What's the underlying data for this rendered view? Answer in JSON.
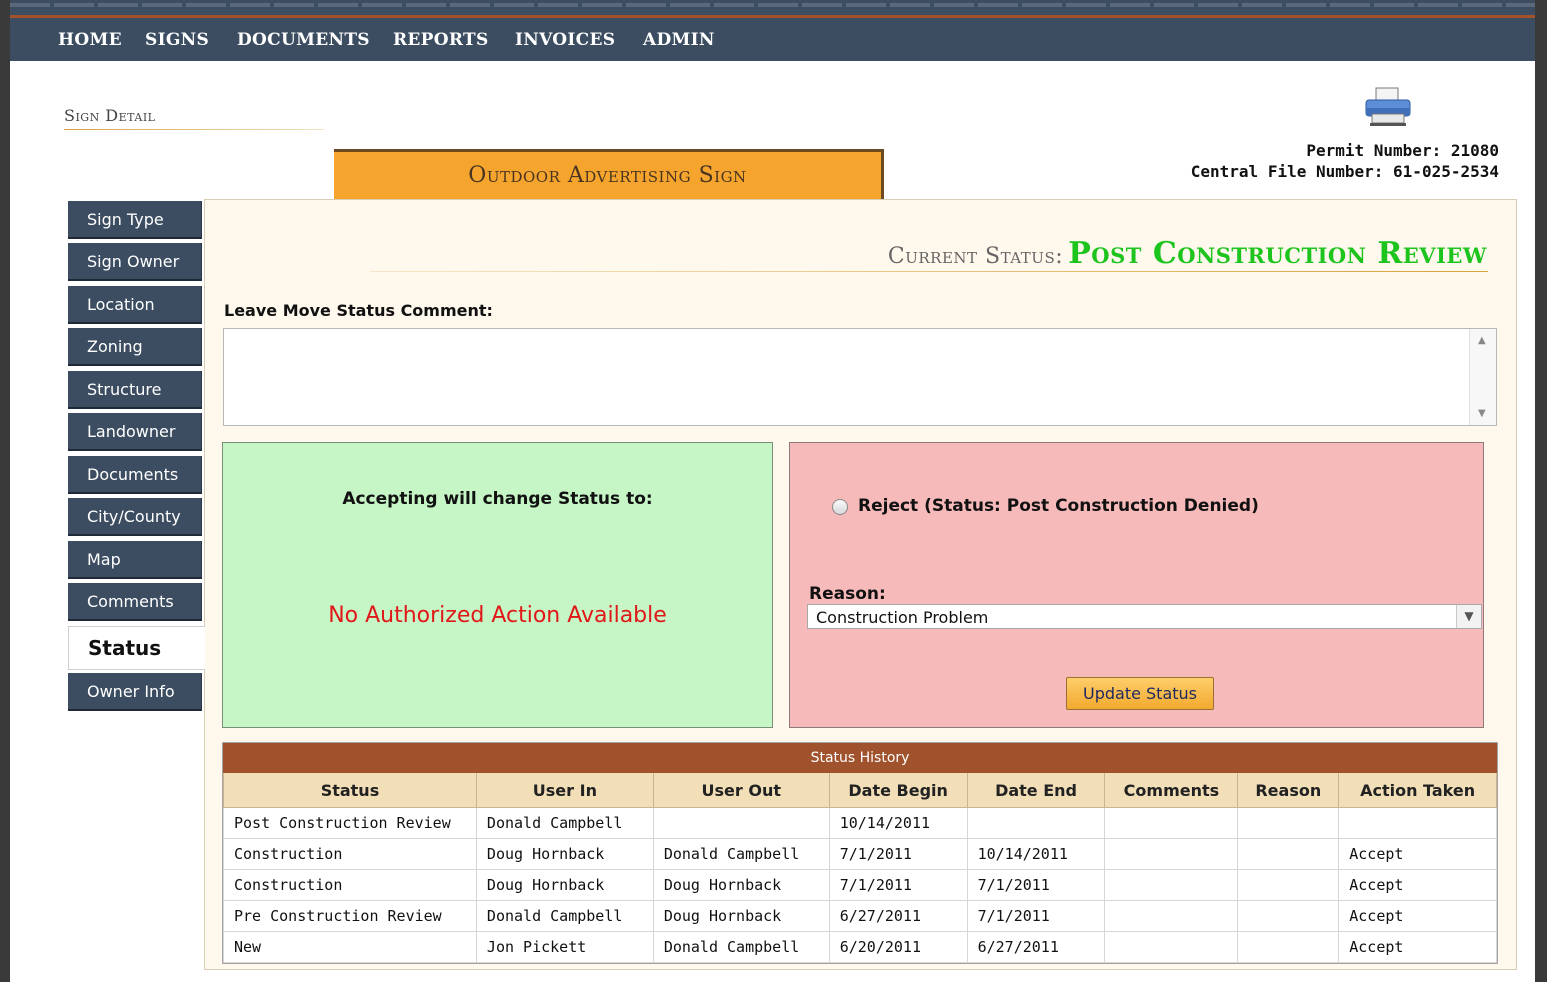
{
  "nav": {
    "home": "HOME",
    "signs": "SIGNS",
    "documents": "DOCUMENTS",
    "reports": "REPORTS",
    "invoices": "INVOICES",
    "admin": "ADMIN"
  },
  "page": {
    "title": "Sign Detail",
    "sign_tab": "Outdoor Advertising Sign",
    "permit_number": "Permit Number: 21080",
    "central_file_number": "Central File Number: 61-025-2534"
  },
  "sidebar": {
    "items": [
      {
        "label": "Sign Type"
      },
      {
        "label": "Sign Owner"
      },
      {
        "label": "Location"
      },
      {
        "label": "Zoning"
      },
      {
        "label": "Structure"
      },
      {
        "label": "Landowner"
      },
      {
        "label": "Documents"
      },
      {
        "label": "City/County"
      },
      {
        "label": "Map"
      },
      {
        "label": "Comments"
      },
      {
        "label": "Status"
      },
      {
        "label": "Owner Info"
      }
    ],
    "active": "Status"
  },
  "status": {
    "label": "Current Status:",
    "value": "Post Construction Review",
    "comment_label": "Leave Move Status Comment:",
    "comment_value": "",
    "accept_title": "Accepting will change Status to:",
    "no_action": "No Authorized Action Available",
    "reject_label": "Reject (Status: Post Construction Denied)",
    "reason_label": "Reason:",
    "reason_selected": "Construction Problem",
    "update_button": "Update Status"
  },
  "history": {
    "caption": "Status History",
    "columns": [
      "Status",
      "User In",
      "User Out",
      "Date Begin",
      "Date End",
      "Comments",
      "Reason",
      "Action Taken"
    ],
    "rows": [
      [
        "Post Construction Review",
        "Donald Campbell",
        "",
        "10/14/2011",
        "",
        "",
        "",
        ""
      ],
      [
        "Construction",
        "Doug Hornback",
        "Donald Campbell",
        "7/1/2011",
        "10/14/2011",
        "",
        "",
        "Accept"
      ],
      [
        "Construction",
        "Doug Hornback",
        "Doug Hornback",
        "7/1/2011",
        "7/1/2011",
        "",
        "",
        "Accept"
      ],
      [
        "Pre Construction Review",
        "Donald Campbell",
        "Doug Hornback",
        "6/27/2011",
        "7/1/2011",
        "",
        "",
        "Accept"
      ],
      [
        "New",
        "Jon Pickett",
        "Donald Campbell",
        "6/20/2011",
        "6/27/2011",
        "",
        "",
        "Accept"
      ]
    ]
  },
  "colors": {
    "nav_bg": "#3c4d61",
    "status_green": "#1ec41e",
    "accept_bg": "#c6f5c6",
    "reject_bg": "#f6baba",
    "history_header": "#a0522d",
    "tab_orange": "#f5a52e",
    "error_red": "#e01818"
  }
}
